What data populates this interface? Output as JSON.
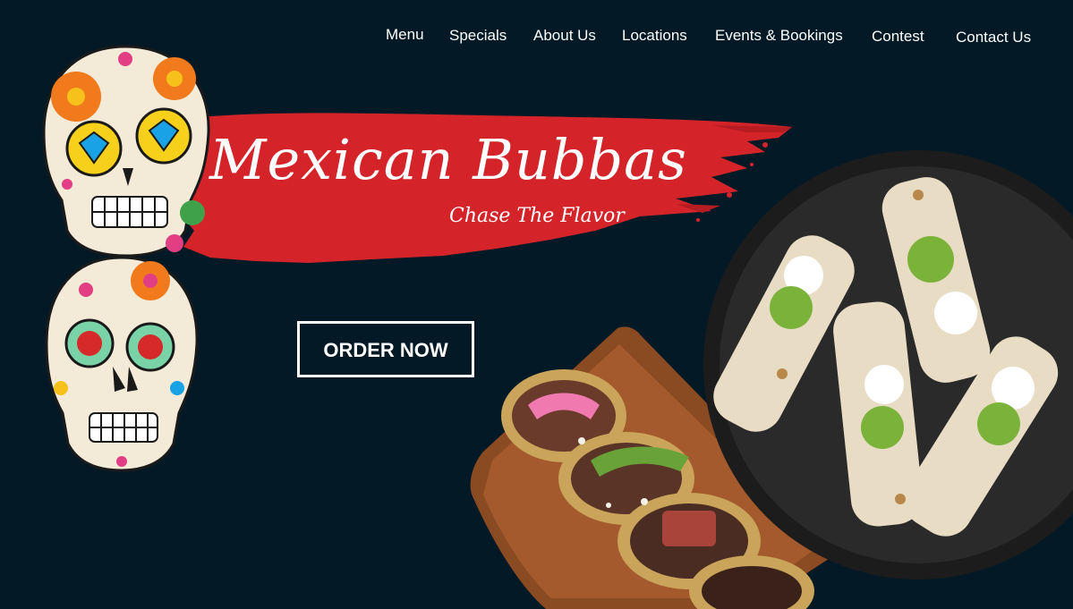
{
  "nav": {
    "items": [
      {
        "label": "Menu"
      },
      {
        "label": "Specials"
      },
      {
        "label": "About Us"
      },
      {
        "label": "Locations"
      },
      {
        "label": "Events & Bookings"
      },
      {
        "label": "Contest"
      },
      {
        "label": "Contact Us"
      }
    ]
  },
  "hero": {
    "title": "Mexican Bubbas",
    "tagline": "Chase The  Flavor",
    "cta_label": "ORDER NOW"
  },
  "colors": {
    "background": "#031a26",
    "brush_red": "#d4242a",
    "text": "#ffffff"
  },
  "icons": [
    "sugar-skull-icon",
    "sugar-skull-rose-icon"
  ]
}
